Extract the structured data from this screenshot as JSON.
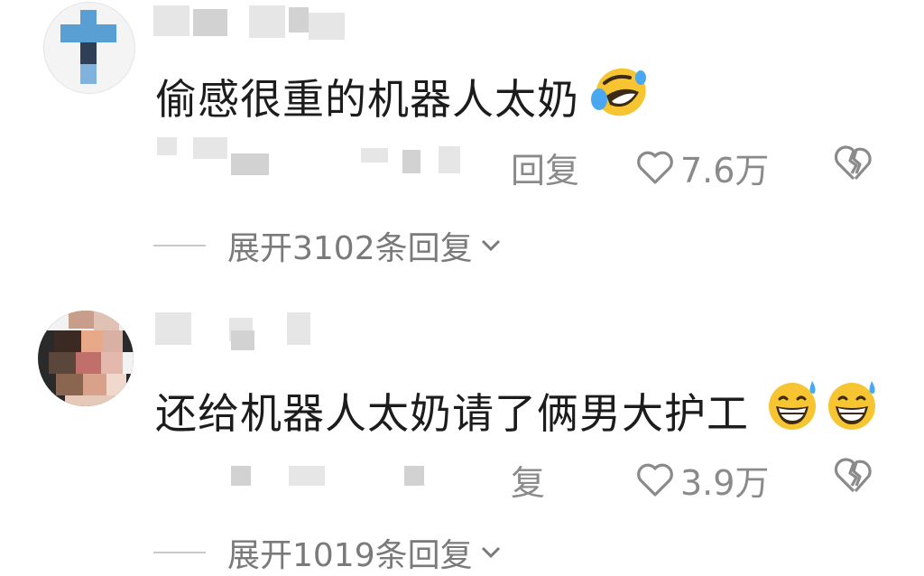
{
  "comments": [
    {
      "text": "偷感很重的机器人太奶",
      "reply_label": "回复",
      "likes": "7.6万",
      "expand_label": "展开3102条回复",
      "emoji": [
        "rolling-on-floor-laughing"
      ]
    },
    {
      "text": "还给机器人太奶请了俩男大护工",
      "reply_label": "复",
      "likes": "3.9万",
      "expand_label": "展开1019条回复",
      "emoji": [
        "grinning-face-with-sweat",
        "grinning-face-with-sweat"
      ]
    }
  ],
  "icons": {
    "like": "heart-outline-icon",
    "dislike": "broken-heart-icon",
    "expand": "chevron-down-icon"
  },
  "colors": {
    "text": "#1c1c1c",
    "meta": "#8a8a8a",
    "emoji_yellow": "#f7c531"
  }
}
